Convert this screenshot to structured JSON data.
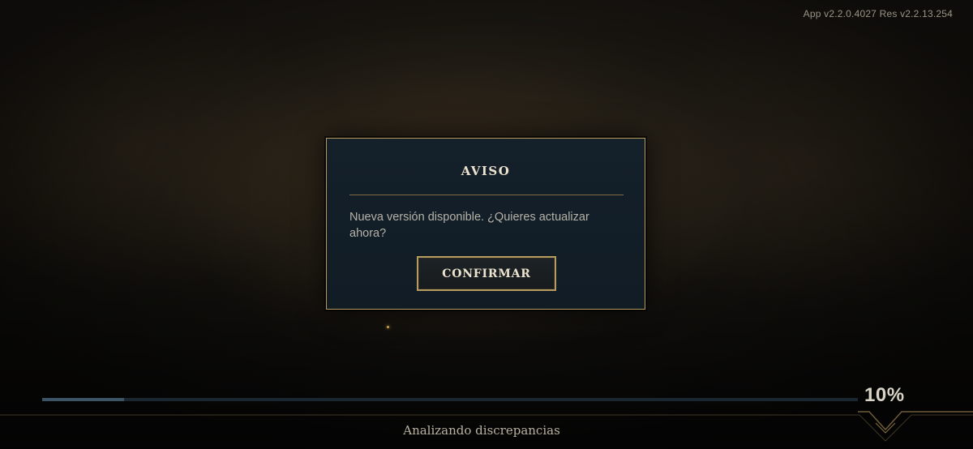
{
  "app": {
    "version_text": "App v2.2.0.4027 Res v2.2.13.254"
  },
  "dialog": {
    "title": "AVISO",
    "message": "Nueva versión disponible. ¿Quieres actualizar ahora?",
    "confirm_label": "CONFIRMAR"
  },
  "loader": {
    "progress": 0.1,
    "percent_text": "10%",
    "status_text": "Analizando discrepancias"
  },
  "colors": {
    "accent_gold": "#b59a5b",
    "dialog_bg": "#14202a",
    "progress_fill": "#3c5466"
  }
}
